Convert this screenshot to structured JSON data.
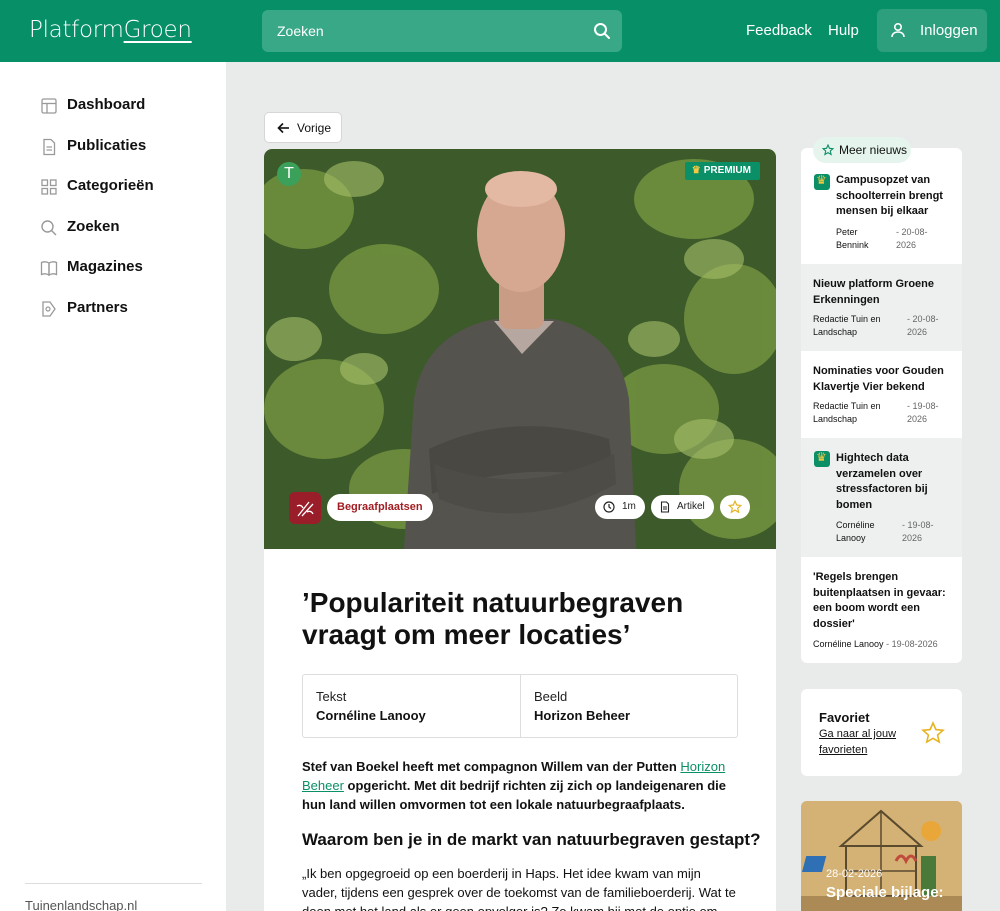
{
  "header": {
    "logo_part1": "Platform",
    "logo_part2": "Groen",
    "search_placeholder": "Zoeken",
    "feedback": "Feedback",
    "help": "Hulp",
    "login": "Inloggen",
    "brand_color": "#079068"
  },
  "sidebar": {
    "items": [
      {
        "label": "Dashboard",
        "icon": "dashboard-icon"
      },
      {
        "label": "Publicaties",
        "icon": "document-icon"
      },
      {
        "label": "Categorieën",
        "icon": "grid-icon"
      },
      {
        "label": "Zoeken",
        "icon": "search-icon"
      },
      {
        "label": "Magazines",
        "icon": "book-icon"
      },
      {
        "label": "Partners",
        "icon": "partners-icon"
      }
    ],
    "footer": "Tuinenlandschap.nl"
  },
  "back_label": "Vorige",
  "article": {
    "badge": "T",
    "premium": "PREMIUM",
    "category": "Begraafplaatsen",
    "read_time": "1m",
    "type": "Artikel",
    "title": "’Populariteit natuurbegraven vraagt om meer locaties’",
    "credit_text_label": "Tekst",
    "credit_text_value": "Cornéline Lanooy",
    "credit_image_label": "Beeld",
    "credit_image_value": "Horizon Beheer",
    "lead_before": "Stef van Boekel heeft met compagnon Willem van der Putten ",
    "lead_link": "Horizon Beheer",
    "lead_after": " opgericht. Met dit bedrijf richten zij zich op landeigenaren die hun land willen omvormen tot een lokale natuurbegraafplaats.",
    "subhead": "Waarom ben je in de markt van natuurbegraven gestapt?",
    "body": "„Ik ben opgegroeid op een boerderij in Haps. Het idee kwam van mijn vader, tijdens een gesprek over de toekomst van de familieboerderij. Wat te doen met het land als er geen opvolger is? Zo kwam hij met de optie om land van kwekers"
  },
  "news": {
    "tab": "Meer nieuws",
    "items": [
      {
        "title": "Campusopzet van schoolterrein brengt mensen bij elkaar",
        "author": "Peter Bennink",
        "date": "- 20-08-2026",
        "premium": true
      },
      {
        "title": "Nieuw platform Groene Erkenningen",
        "author": "Redactie Tuin en Landschap",
        "date": "- 20-08-2026",
        "premium": false
      },
      {
        "title": "Nominaties voor Gouden Klavertje Vier bekend",
        "author": "Redactie Tuin en Landschap",
        "date": "- 19-08-2026",
        "premium": false
      },
      {
        "title": "Hightech data verzamelen over stressfactoren bij bomen",
        "author": "Cornéline Lanooy",
        "date": "- 19-08-2026",
        "premium": true
      },
      {
        "title": "'Regels brengen buitenplaatsen in gevaar: een boom wordt een dossier'",
        "author": "Cornéline Lanooy",
        "date": "- 19-08-2026",
        "premium": false
      }
    ]
  },
  "favorites": {
    "title": "Favoriet",
    "link": "Ga naar al jouw favorieten"
  },
  "magazine": {
    "date": "28-02-2026",
    "title": "Speciale bijlage:"
  }
}
